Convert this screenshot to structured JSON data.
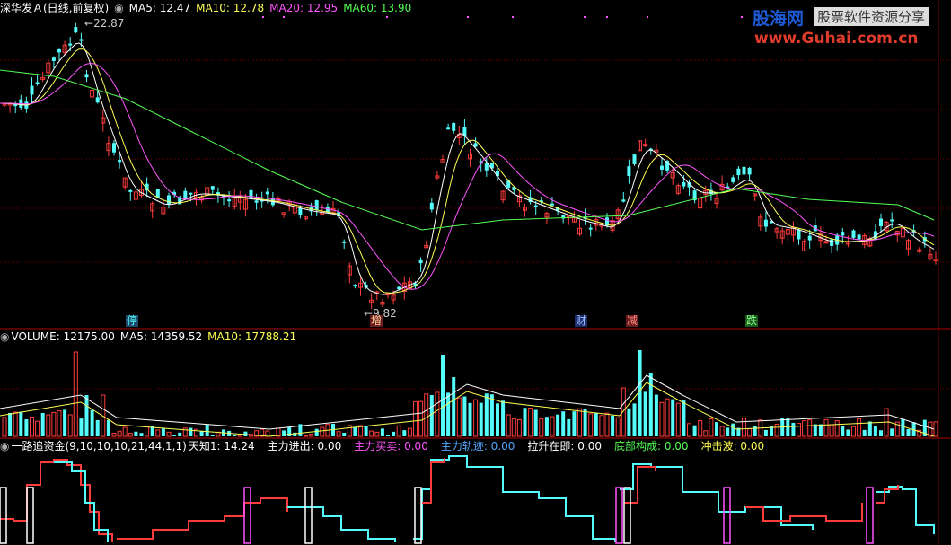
{
  "price_header": {
    "stock_name": "深华发Ａ(日线,前复权)",
    "ma5": "MA5: 12.47",
    "ma10": "MA10: 12.78",
    "ma20": "MA20: 12.95",
    "ma60": "MA60: 13.90"
  },
  "price_annotations": {
    "high": "22.87",
    "low": "9.82"
  },
  "event_tags": [
    "停",
    "增",
    "财",
    "减",
    "跌"
  ],
  "volume_header": {
    "title": "VOLUME: 12175.00",
    "ma5": "MA5: 14359.52",
    "ma10": "MA10: 17788.21"
  },
  "indicator_header": {
    "name": "一路追资金(9,10,10,10,21,44,1,1)",
    "tianzhi": "天知1: 14.24",
    "zhuli_jinchu": "主力进出: 0.00",
    "zhuli_maimai": "主力买卖: 0.00",
    "zhuli_guiji": "主力轨迹: 0.00",
    "lasheng": "拉升在即: 0.00",
    "dibu": "底部构成: 0.00",
    "chongji": "冲击波: 0.00"
  },
  "watermark": {
    "brand": "股海网",
    "slogan": "股票软件资源分享",
    "url": "www.Guhai.com.cn"
  },
  "colors": {
    "background": "#000000",
    "up": "#ff3c3c",
    "down": "#54fcfc",
    "ma5": "#ffffff",
    "ma10": "#ffff54",
    "ma20": "#ff54ff",
    "ma60": "#54ff54",
    "grid": "#a00000"
  },
  "icons": [
    "collapse-circle-icon"
  ]
}
